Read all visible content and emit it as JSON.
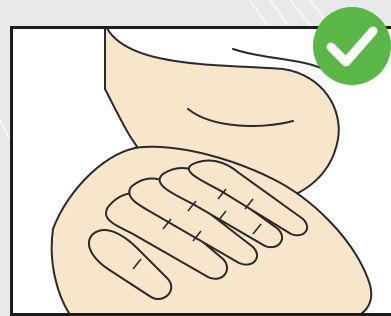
{
  "illustration": {
    "subject": "hands-overlapping",
    "status_badge": "checkmark-icon"
  },
  "colors": {
    "background": "#e9e9e9",
    "panel": "#ffffff",
    "frame": "#1c1c1c",
    "skin": "#f7e6cb",
    "outline": "#2a2a2a",
    "badge": "#5bb648",
    "check": "#ffffff"
  }
}
